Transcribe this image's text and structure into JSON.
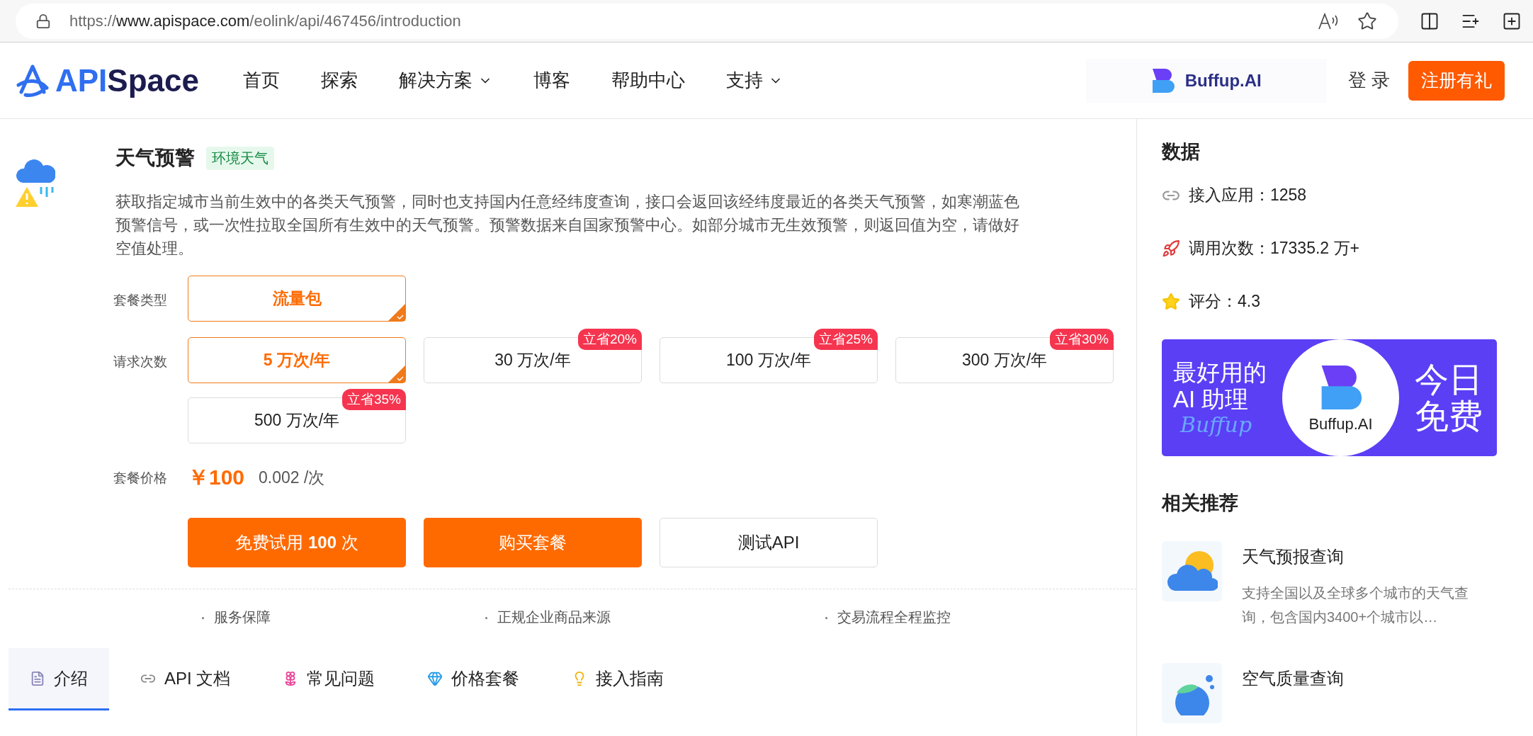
{
  "browser": {
    "url_host": "https://www.apispace.com",
    "url_path": "/eolink/api/467456/introduction"
  },
  "header": {
    "logo": {
      "brand_a": "API",
      "brand_b": "Space"
    },
    "nav": [
      {
        "label": "首页",
        "dropdown": false
      },
      {
        "label": "探索",
        "dropdown": false
      },
      {
        "label": "解决方案",
        "dropdown": true
      },
      {
        "label": "博客",
        "dropdown": false
      },
      {
        "label": "帮助中心",
        "dropdown": false
      },
      {
        "label": "支持",
        "dropdown": true
      }
    ],
    "ad": "Buffup.AI",
    "login": "登 录",
    "register": "注册有礼"
  },
  "api": {
    "title": "天气预警",
    "tag": "环境天气",
    "description": "获取指定城市当前生效中的各类天气预警，同时也支持国内任意经纬度查询，接口会返回该经纬度最近的各类天气预警，如寒潮蓝色预警信号，或一次性拉取全国所有生效中的天气预警。预警数据来自国家预警中心。如部分城市无生效预警，则返回值为空，请做好空值处理。"
  },
  "package_type": {
    "label": "套餐类型",
    "options": [
      {
        "label": "流量包",
        "selected": true
      }
    ]
  },
  "request_count": {
    "label": "请求次数",
    "options": [
      {
        "label": "5 万次/年",
        "selected": true
      },
      {
        "label": "30 万次/年",
        "selected": false,
        "discount": "立省20%"
      },
      {
        "label": "100 万次/年",
        "selected": false,
        "discount": "立省25%"
      },
      {
        "label": "300 万次/年",
        "selected": false,
        "discount": "立省30%"
      },
      {
        "label": "500 万次/年",
        "selected": false,
        "discount": "立省35%"
      }
    ]
  },
  "price": {
    "label": "套餐价格",
    "amount": "￥100",
    "unit_price": "0.002 /次"
  },
  "actions": [
    {
      "label": "免费试用 **100** 次",
      "kind": "primary"
    },
    {
      "label": "购买套餐",
      "kind": "primary"
    },
    {
      "label": "测试API",
      "kind": "outline"
    }
  ],
  "guarantees": [
    "服务保障",
    "正规企业商品来源",
    "交易流程全程监控"
  ],
  "tabs": [
    {
      "label": "介绍",
      "kind": "doc",
      "selected": true
    },
    {
      "label": "API 文档",
      "kind": "link",
      "selected": false
    },
    {
      "label": "常见问题",
      "kind": "flower",
      "selected": false
    },
    {
      "label": "价格套餐",
      "kind": "gem",
      "selected": false
    },
    {
      "label": "接入指南",
      "kind": "bulb",
      "selected": false
    }
  ],
  "sidebar": {
    "data_title": "数据",
    "stats": [
      {
        "kind": "link",
        "text": "接入应用：1258"
      },
      {
        "kind": "rocket",
        "text": "调用次数：17335.2 万+"
      },
      {
        "kind": "star",
        "text": "评分：4.3"
      }
    ],
    "banner": {
      "line_1": "最好用的",
      "line_2": "AI 助理",
      "script": "Buffup",
      "logo_text": "Buffup.AI",
      "right_1": "今日",
      "right_2": "免费"
    },
    "related_title": "相关推荐",
    "related": [
      {
        "kind": "sun-cloud",
        "title": "天气预报查询",
        "description": "支持全国以及全球多个城市的天气查询，包含国内3400+个城市以…"
      },
      {
        "kind": "air",
        "title": "空气质量查询"
      }
    ]
  }
}
